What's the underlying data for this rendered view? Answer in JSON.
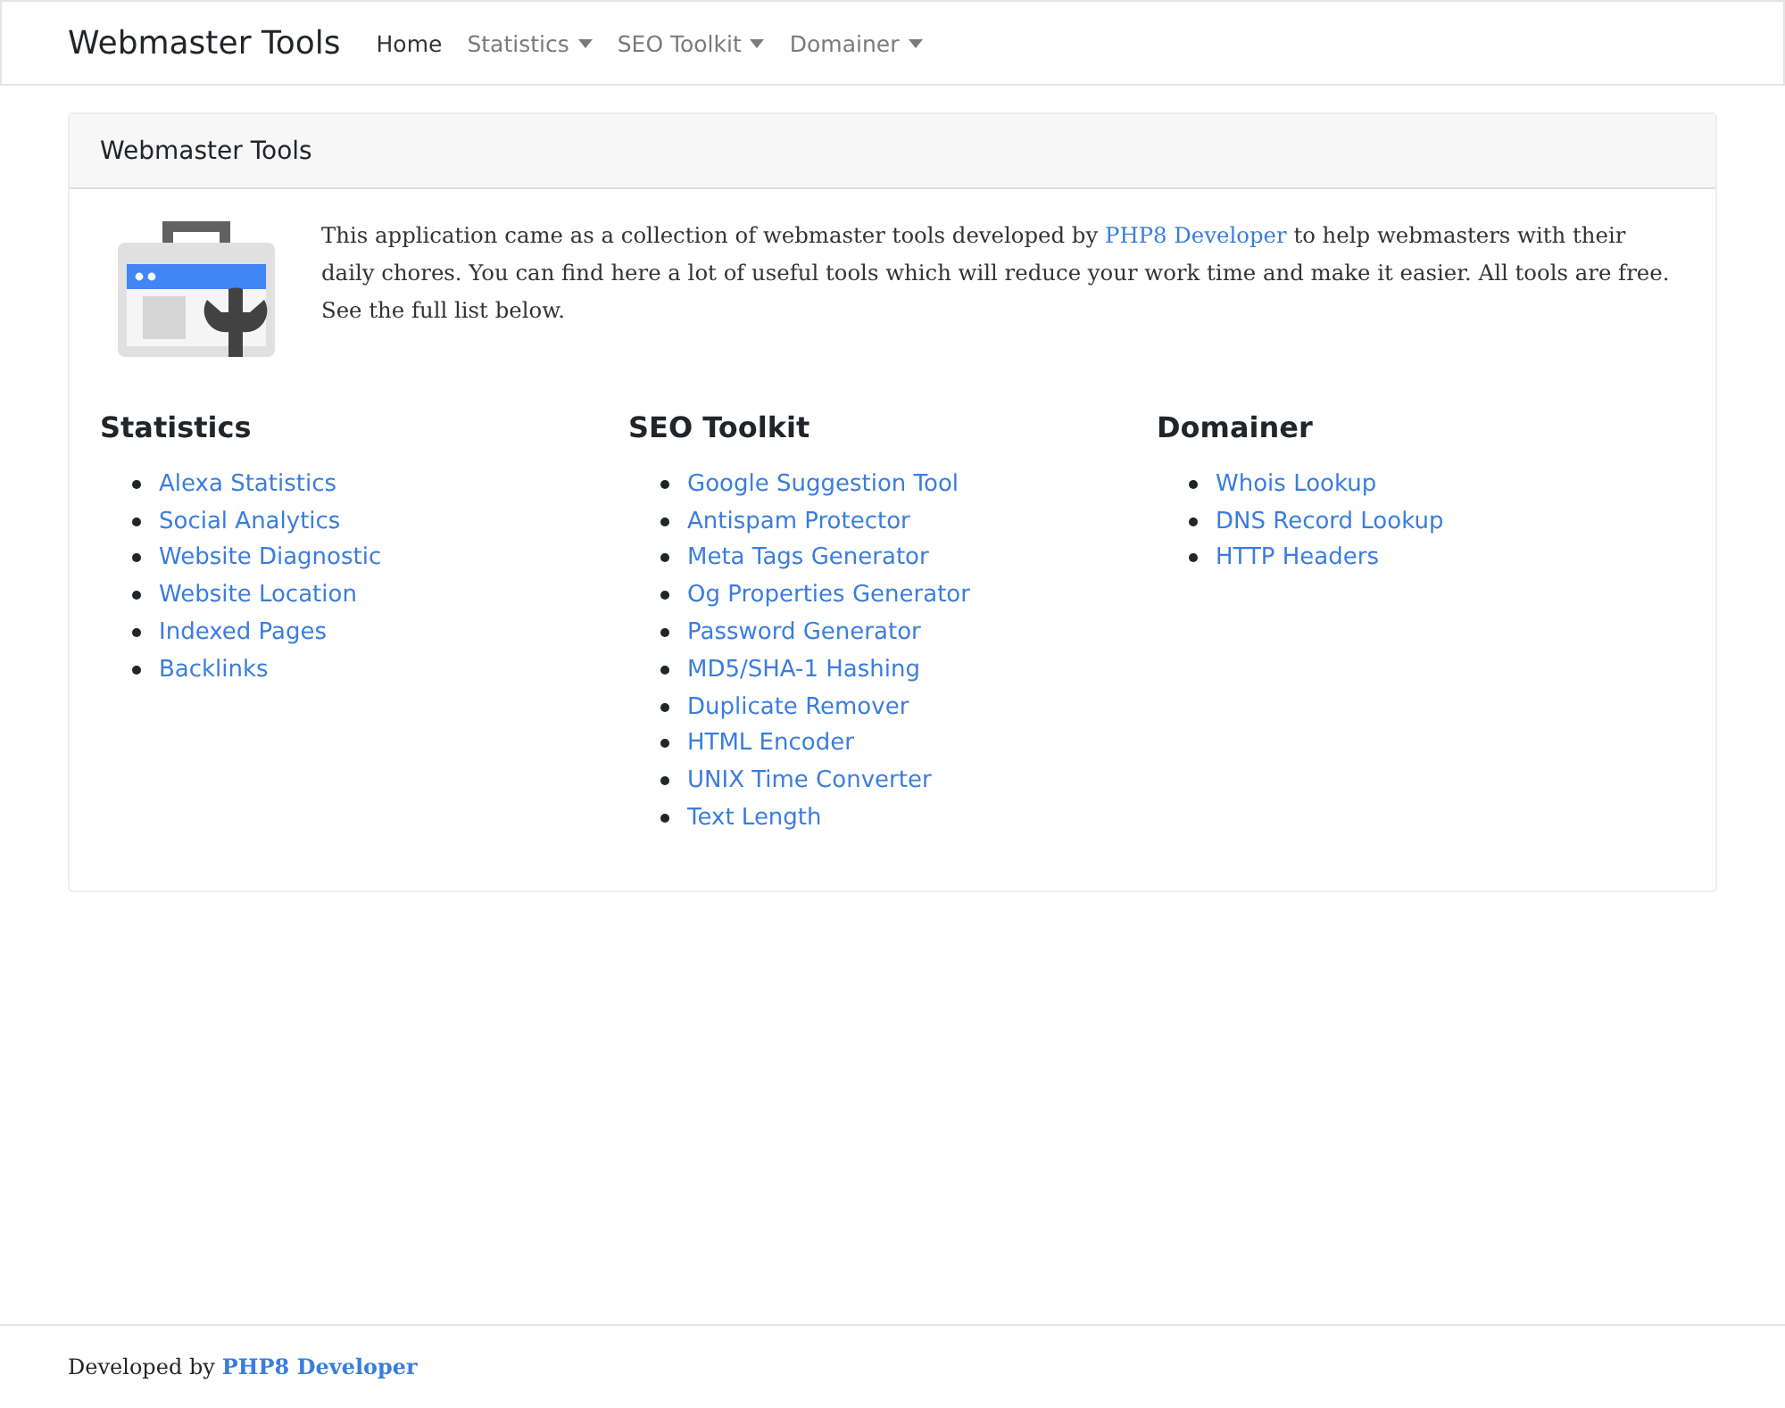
{
  "navbar": {
    "brand": "Webmaster Tools",
    "items": [
      {
        "label": "Home",
        "selected": true,
        "dropdown": false
      },
      {
        "label": "Statistics",
        "selected": false,
        "dropdown": true
      },
      {
        "label": "SEO Toolkit",
        "selected": false,
        "dropdown": true
      },
      {
        "label": "Domainer",
        "selected": false,
        "dropdown": true
      }
    ]
  },
  "card": {
    "header": "Webmaster Tools",
    "intro": {
      "before": "This application came as a collection of webmaster tools developed by",
      "link": "PHP8 Developer",
      "after": "to help webmasters with their daily chores. You can find here a lot of useful tools which will reduce your work time and make it easier. All tools are free. See the full list below."
    },
    "sections": [
      {
        "title": "Statistics",
        "links": [
          "Alexa Statistics",
          "Social Analytics",
          "Website Diagnostic",
          "Website Location",
          "Indexed Pages",
          "Backlinks"
        ]
      },
      {
        "title": "SEO Toolkit",
        "links": [
          "Google Suggestion Tool",
          "Antispam Protector",
          "Meta Tags Generator",
          "Og Properties Generator",
          "Password Generator",
          "MD5/SHA-1 Hashing",
          "Duplicate Remover",
          "HTML Encoder",
          "UNIX Time Converter",
          "Text Length"
        ]
      },
      {
        "title": "Domainer",
        "links": [
          "Whois Lookup",
          "DNS Record Lookup",
          "HTTP Headers"
        ]
      }
    ]
  },
  "footer": {
    "text": "Developed by",
    "link": "PHP8 Developer"
  }
}
